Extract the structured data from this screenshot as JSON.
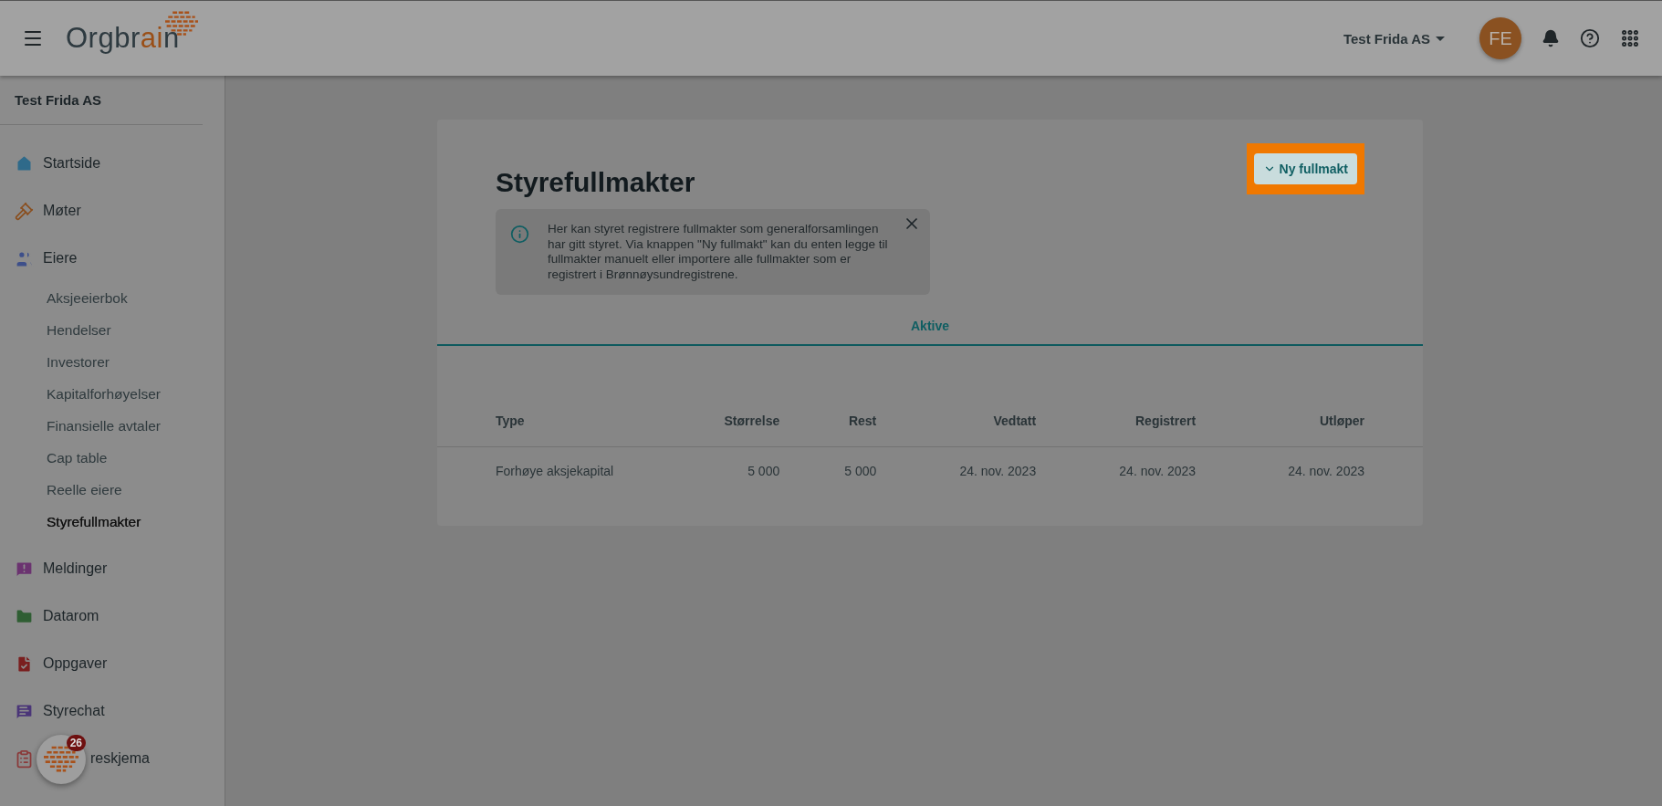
{
  "top_bar": {
    "logo_text": "Orgbrain",
    "company_menu": "Test Frida AS",
    "avatar": "FE"
  },
  "sidebar": {
    "company": "Test Frida AS",
    "items": [
      {
        "label": "Startside",
        "color": "#2f6a8a"
      },
      {
        "label": "Møter",
        "color": "#8a4f1f"
      },
      {
        "label": "Eiere",
        "color": "#3d4f8a",
        "children": [
          {
            "label": "Aksjeeierbok",
            "selected": false
          },
          {
            "label": "Hendelser",
            "selected": false
          },
          {
            "label": "Investorer",
            "selected": false
          },
          {
            "label": "Kapitalforhøyelser",
            "selected": false
          },
          {
            "label": "Finansielle avtaler",
            "selected": false
          },
          {
            "label": "Cap table",
            "selected": false
          },
          {
            "label": "Reelle eiere",
            "selected": false
          },
          {
            "label": "Styrefullmakter",
            "selected": true
          }
        ]
      },
      {
        "label": "Meldinger",
        "color": "#6b3370"
      },
      {
        "label": "Datarom",
        "color": "#2f5e33"
      },
      {
        "label": "Oppgaver",
        "color": "#7a1f1f"
      },
      {
        "label": "Styrechat",
        "color": "#4a3578"
      },
      {
        "label": "reskjema",
        "color": "#8a3a3a",
        "covered_by_bubble": true
      }
    ]
  },
  "chat_bubble": {
    "badge": "26"
  },
  "page": {
    "title": "Styrefullmakter",
    "new_button": "Ny fullmakt",
    "new_button_highlighted": true,
    "info": "Her kan styret registrere fullmakter som generalforsamlingen har gitt styret. Via knappen \"Ny fullmakt\" kan du enten legge til fullmakter manuelt eller importere alle fullmakter som er registrert i Brønnøysundregistrene.",
    "tabs": [
      {
        "label": "Aktive",
        "selected": true
      }
    ],
    "table": {
      "columns": [
        "Type",
        "Størrelse",
        "Rest",
        "Vedtatt",
        "Registrert",
        "Utløper"
      ],
      "rows": [
        [
          "Forhøye aksjekapital",
          "5 000",
          "5 000",
          "24. nov. 2023",
          "24. nov. 2023",
          "24. nov. 2023"
        ]
      ]
    }
  }
}
